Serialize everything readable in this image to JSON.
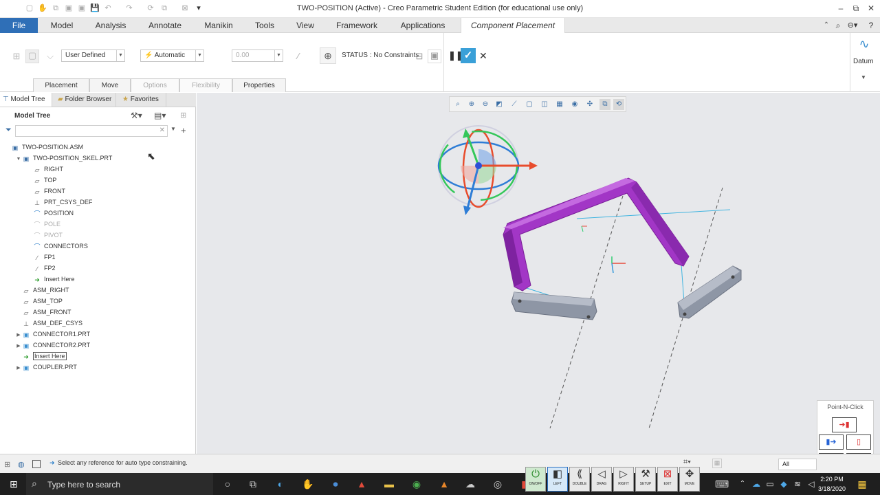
{
  "window": {
    "title": "TWO-POSITION (Active) - Creo Parametric Student Edition (for educational use only)"
  },
  "menu": {
    "items": [
      "File",
      "Model",
      "Analysis",
      "Annotate",
      "Manikin",
      "Tools",
      "View",
      "Framework",
      "Applications",
      "Component Placement"
    ]
  },
  "ribbon": {
    "constraint_type": "User Defined",
    "constraint_mode": "Automatic",
    "offset_value": "0.00",
    "status": "STATUS : No Constraints",
    "datum_label": "Datum",
    "subtabs": [
      "Placement",
      "Move",
      "Options",
      "Flexibility",
      "Properties"
    ]
  },
  "panel": {
    "tabs": [
      "Model Tree",
      "Folder Browser",
      "Favorites"
    ],
    "header": "Model Tree",
    "tree": [
      {
        "label": "TWO-POSITION.ASM",
        "indent": 0,
        "icon": "assembly-icon",
        "twisty": "",
        "dim": false
      },
      {
        "label": "TWO-POSITION_SKEL.PRT",
        "indent": 1,
        "icon": "skeleton-part-icon",
        "twisty": "▼",
        "dim": false
      },
      {
        "label": "RIGHT",
        "indent": 2,
        "icon": "datum-plane-icon",
        "twisty": "",
        "dim": false
      },
      {
        "label": "TOP",
        "indent": 2,
        "icon": "datum-plane-icon",
        "twisty": "",
        "dim": false
      },
      {
        "label": "FRONT",
        "indent": 2,
        "icon": "datum-plane-icon",
        "twisty": "",
        "dim": false
      },
      {
        "label": "PRT_CSYS_DEF",
        "indent": 2,
        "icon": "csys-icon",
        "twisty": "",
        "dim": false
      },
      {
        "label": "POSITION",
        "indent": 2,
        "icon": "sketch-icon",
        "twisty": "",
        "dim": false
      },
      {
        "label": "POLE",
        "indent": 2,
        "icon": "sketch-icon",
        "twisty": "",
        "dim": true
      },
      {
        "label": "PIVOT",
        "indent": 2,
        "icon": "sketch-icon",
        "twisty": "",
        "dim": true
      },
      {
        "label": "CONNECTORS",
        "indent": 2,
        "icon": "sketch-icon",
        "twisty": "",
        "dim": false
      },
      {
        "label": "FP1",
        "indent": 2,
        "icon": "datum-axis-icon",
        "twisty": "",
        "dim": false
      },
      {
        "label": "FP2",
        "indent": 2,
        "icon": "datum-axis-icon",
        "twisty": "",
        "dim": false
      },
      {
        "label": "Insert Here",
        "indent": 2,
        "icon": "insert-arrow-icon",
        "twisty": "",
        "dim": false
      },
      {
        "label": "ASM_RIGHT",
        "indent": 1,
        "icon": "datum-plane-icon",
        "twisty": "",
        "dim": false
      },
      {
        "label": "ASM_TOP",
        "indent": 1,
        "icon": "datum-plane-icon",
        "twisty": "",
        "dim": false
      },
      {
        "label": "ASM_FRONT",
        "indent": 1,
        "icon": "datum-plane-icon",
        "twisty": "",
        "dim": false
      },
      {
        "label": "ASM_DEF_CSYS",
        "indent": 1,
        "icon": "csys-icon",
        "twisty": "",
        "dim": false
      },
      {
        "label": "CONNECTOR1.PRT",
        "indent": 1,
        "icon": "part-icon",
        "twisty": "▶",
        "dim": false
      },
      {
        "label": "CONNECTOR2.PRT",
        "indent": 1,
        "icon": "part-icon",
        "twisty": "▶",
        "dim": false
      },
      {
        "label": "Insert Here",
        "indent": 1,
        "icon": "insert-arrow-icon",
        "twisty": "",
        "dim": false,
        "boxed": true
      },
      {
        "label": "COUPLER.PRT",
        "indent": 1,
        "icon": "part-icon",
        "twisty": "▶",
        "dim": false
      }
    ]
  },
  "status_bar": {
    "message": "Select any reference for auto type constraining.",
    "filter": "All"
  },
  "taskbar": {
    "search_placeholder": "Type here to search",
    "time": "2:20 PM",
    "date": "3/18/2020"
  },
  "pointnclick": {
    "title": "Point-N-Click"
  },
  "remote": {
    "buttons": [
      "ON/OFF",
      "LEFT",
      "DOUBLE",
      "DRAG",
      "RIGHT",
      "SETUP",
      "EXIT",
      "MOVE"
    ]
  }
}
